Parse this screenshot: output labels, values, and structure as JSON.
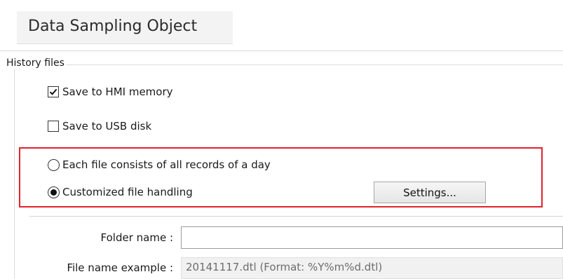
{
  "title": "Data Sampling Object",
  "history_files": {
    "group_label": "History files",
    "save_to_hmi": {
      "label": "Save to HMI memory",
      "checked": true
    },
    "save_to_usb": {
      "label": "Save to USB disk",
      "checked": false
    },
    "options": [
      {
        "label": "Each file consists of all records of a day",
        "selected": false
      },
      {
        "label": "Customized file handling",
        "selected": true
      }
    ],
    "settings_button": "Settings...",
    "highlight_color": "#e3212b"
  },
  "folder": {
    "label": "Folder name :",
    "value": ""
  },
  "file_name_example": {
    "label": "File name example :",
    "value": "20141117.dtl (Format: %Y%m%d.dtl)"
  }
}
